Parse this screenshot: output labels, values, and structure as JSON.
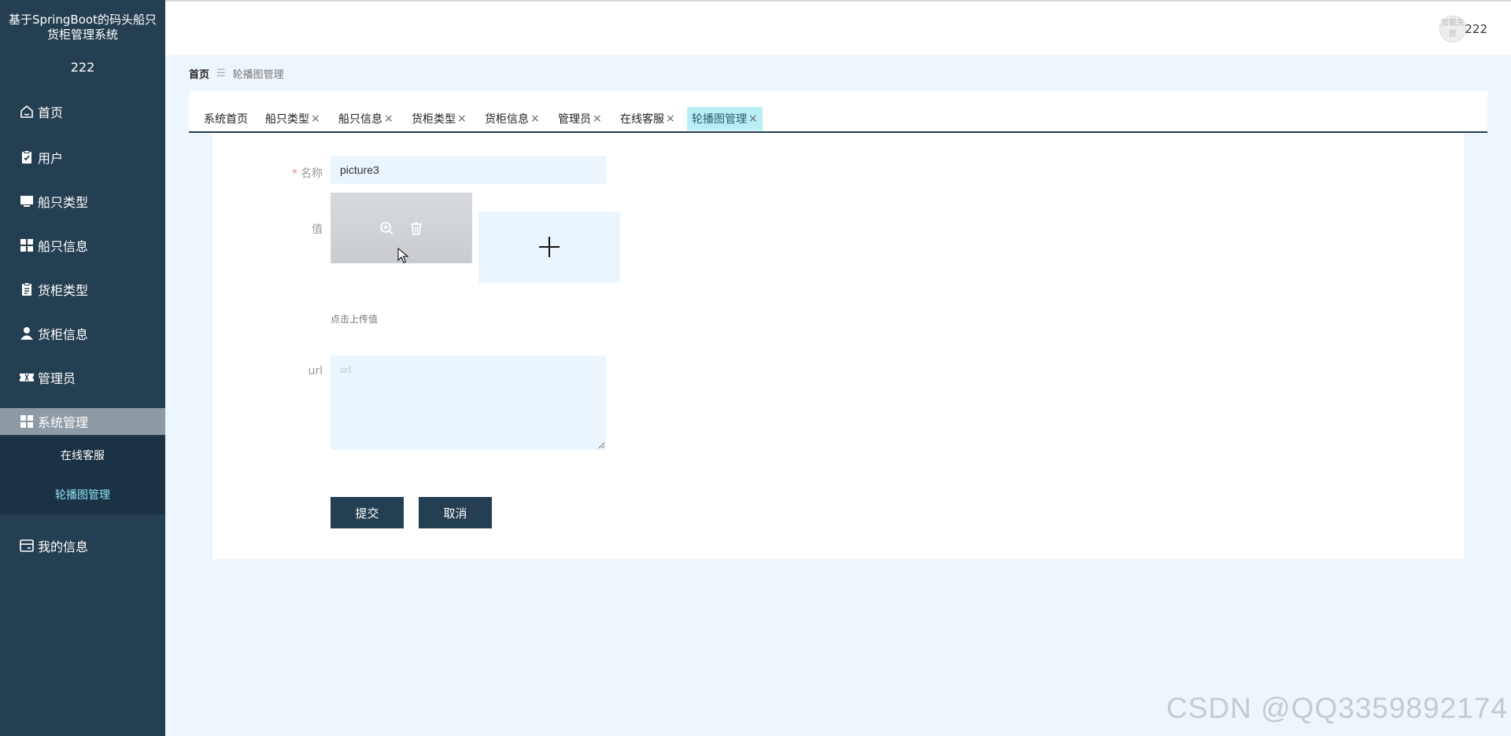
{
  "sidebar": {
    "title": "基于SpringBoot的码头船只货柜管理系统",
    "username": "222",
    "items": [
      {
        "label": "首页",
        "icon": "home-icon"
      },
      {
        "label": "用户",
        "icon": "clipboard-check-icon"
      },
      {
        "label": "船只类型",
        "icon": "monitor-icon"
      },
      {
        "label": "船只信息",
        "icon": "grid-icon"
      },
      {
        "label": "货柜类型",
        "icon": "clipboard-icon"
      },
      {
        "label": "货柜信息",
        "icon": "user-icon"
      },
      {
        "label": "管理员",
        "icon": "ticket-icon"
      },
      {
        "label": "系统管理",
        "icon": "grid-icon"
      },
      {
        "label": "我的信息",
        "icon": "wallet-icon"
      }
    ],
    "submenu": [
      {
        "label": "在线客服"
      },
      {
        "label": "轮播图管理"
      }
    ]
  },
  "topbar": {
    "username": "222",
    "avatar_text": "加载失败"
  },
  "breadcrumb": {
    "home": "首页",
    "separator": "☰",
    "current": "轮播图管理"
  },
  "tabs": [
    {
      "label": "系统首页",
      "closable": false
    },
    {
      "label": "船只类型",
      "closable": true
    },
    {
      "label": "船只信息",
      "closable": true
    },
    {
      "label": "货柜类型",
      "closable": true
    },
    {
      "label": "货柜信息",
      "closable": true
    },
    {
      "label": "管理员",
      "closable": true
    },
    {
      "label": "在线客服",
      "closable": true
    },
    {
      "label": "轮播图管理",
      "closable": true,
      "active": true
    }
  ],
  "tab_close_glyph": "×",
  "form": {
    "name_label": "名称",
    "required_mark": "*",
    "name_value": "picture3",
    "value_label": "值",
    "upload_tip": "点击上传值",
    "url_label": "url",
    "url_placeholder": "url",
    "url_value": "",
    "submit_label": "提交",
    "cancel_label": "取消"
  },
  "watermark": "CSDN @QQ3359892174",
  "colors": {
    "sidebar_bg": "#243e52",
    "accent": "#243e52",
    "active_tab": "#b8eff5",
    "input_bg": "#ebf5fe"
  }
}
